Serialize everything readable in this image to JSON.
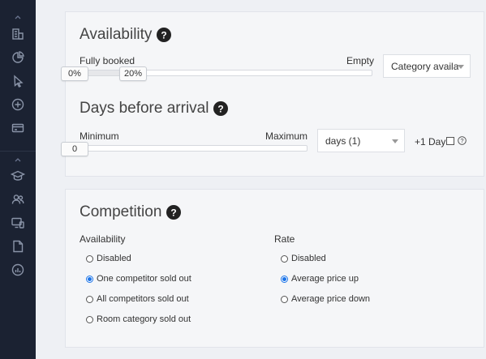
{
  "sidebar": {
    "top_icons": [
      {
        "name": "building-chart-icon"
      },
      {
        "name": "pie-chart-icon"
      },
      {
        "name": "pointer-click-icon"
      },
      {
        "name": "plus-circle-icon"
      },
      {
        "name": "credit-card-icon"
      }
    ],
    "bottom_icons": [
      {
        "name": "graduation-cap-icon"
      },
      {
        "name": "users-icon"
      },
      {
        "name": "devices-icon"
      },
      {
        "name": "document-icon"
      },
      {
        "name": "bar-chart-icon"
      }
    ]
  },
  "availability": {
    "title": "Availability",
    "left_label": "Fully booked",
    "right_label": "Empty",
    "min_value": "0%",
    "max_value": "20%",
    "range_fraction": 0.2,
    "select_value": "Category availa"
  },
  "days": {
    "title": "Days before arrival",
    "min_label": "Minimum",
    "max_label": "Maximum",
    "min_value": "0",
    "select_value": "days (1)",
    "plus_one_label": "+1 Day",
    "plus_one_checked": false
  },
  "competition": {
    "title": "Competition",
    "availability_label": "Availability",
    "availability_options": [
      {
        "label": "Disabled",
        "checked": false
      },
      {
        "label": "One competitor sold out",
        "checked": true
      },
      {
        "label": "All competitors sold out",
        "checked": false
      },
      {
        "label": "Room category sold out",
        "checked": false
      }
    ],
    "rate_label": "Rate",
    "rate_options": [
      {
        "label": "Disabled",
        "checked": false
      },
      {
        "label": "Average price up",
        "checked": true
      },
      {
        "label": "Average price down",
        "checked": false
      }
    ]
  },
  "colors": {
    "sidebar_bg": "#1b2232",
    "sidebar_icon": "#8a94a8",
    "accent": "#1a73e8"
  }
}
